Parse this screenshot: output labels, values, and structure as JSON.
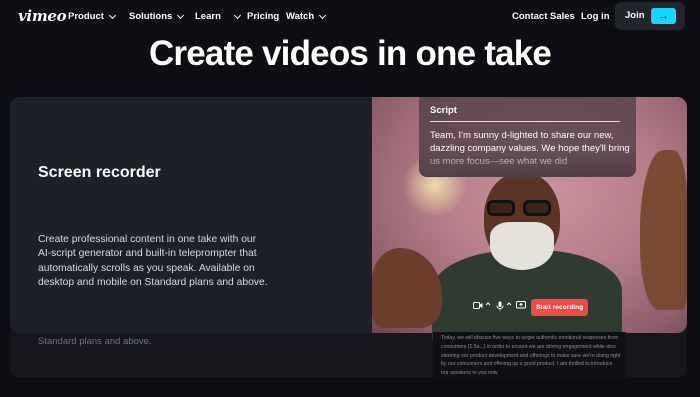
{
  "nav": {
    "logo": "vimeo",
    "items": [
      {
        "label": "Product",
        "dropdown": true
      },
      {
        "label": "Solutions",
        "dropdown": true
      },
      {
        "label": "Learn",
        "dropdown": true
      },
      {
        "label": "Pricing",
        "dropdown": false
      },
      {
        "label": "Watch",
        "dropdown": true
      }
    ],
    "contact_sales": "Contact Sales",
    "login": "Log in",
    "join": "Join",
    "join_arrow": "→"
  },
  "hero": {
    "headline": "Create videos in one take"
  },
  "feature": {
    "title": "Screen recorder",
    "description": "Create professional content in one take with our AI-script generator and built-in teleprompter that automatically scrolls as you speak. Available on desktop and mobile on Standard plans and above.",
    "ghost_text": "Standard plans and above."
  },
  "script_panel": {
    "title": "Script",
    "text": "Team, I'm sunny d-lighted to share our new, dazzling company values. We hope they'll bring us more focus—see what we did"
  },
  "recorder": {
    "start_label": "Start recording",
    "icons": [
      "camera-icon",
      "chevron-up-icon",
      "microphone-icon",
      "chevron-up-icon",
      "screen-share-icon"
    ]
  },
  "phone_script": {
    "text": "Today, we will discuss five ways to target authentic emotional responses from consumers (1.5s...) in order to ensure we are driving engagement while also steering our product development and offerings to make sure we're doing right by our consumers and offering up a good product. I am thrilled to introduce our speakers to you now"
  },
  "colors": {
    "background": "#0d0e12",
    "card": "#1d2028",
    "accent": "#17d5ff",
    "record": "#ef4b46"
  }
}
